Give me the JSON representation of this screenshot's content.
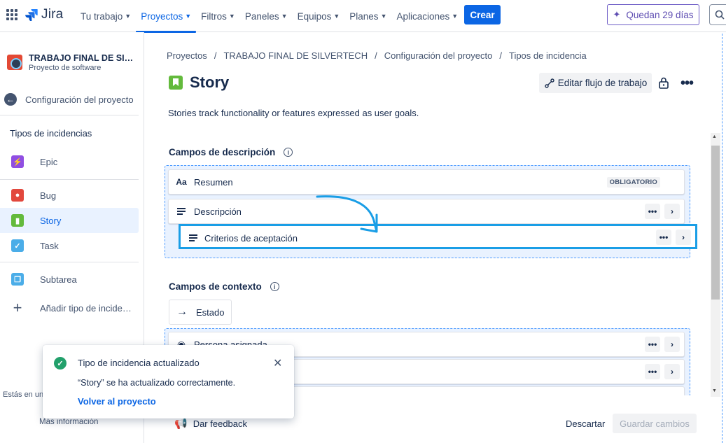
{
  "topbar": {
    "logo_text": "Jira",
    "nav": [
      {
        "label": "Tu trabajo"
      },
      {
        "label": "Proyectos"
      },
      {
        "label": "Filtros"
      },
      {
        "label": "Paneles"
      },
      {
        "label": "Equipos"
      },
      {
        "label": "Planes"
      },
      {
        "label": "Aplicaciones"
      }
    ],
    "create_label": "Crear",
    "trial_label": "Quedan 29 días"
  },
  "sidebar": {
    "project_name": "TRABAJO FINAL DE SILVERTECH",
    "project_type": "Proyecto de software",
    "back_label": "Configuración del proyecto",
    "section_title": "Tipos de incidencias",
    "items": [
      {
        "label": "Epic",
        "icon": "epic-icon"
      },
      {
        "label": "Bug",
        "icon": "bug-icon"
      },
      {
        "label": "Story",
        "icon": "story-icon"
      },
      {
        "label": "Task",
        "icon": "task-icon"
      },
      {
        "label": "Subtarea",
        "icon": "subtask-icon"
      },
      {
        "label": "Añadir tipo de incidencia",
        "icon": "plus-icon"
      }
    ],
    "footer_text": "Estás en un",
    "more_info": "Más información"
  },
  "breadcrumbs": [
    "Proyectos",
    "/",
    "TRABAJO FINAL DE SILVERTECH",
    "/",
    "Configuración del proyecto",
    "/",
    "Tipos de incidencia"
  ],
  "header": {
    "title": "Story",
    "edit_workflow_label": "Editar flujo de trabajo",
    "description": "Stories track functionality or features expressed as user goals."
  },
  "description_fields": {
    "title": "Campos de descripción",
    "fields": [
      {
        "label": "Resumen",
        "icon": "Aa",
        "badge": "OBLIGATORIO"
      },
      {
        "label": "Descripción"
      },
      {
        "label": "Criterios de aceptación"
      }
    ]
  },
  "context_fields": {
    "title": "Campos de contexto",
    "estado_label": "Estado",
    "fields": [
      {
        "label": "Persona asignada"
      }
    ]
  },
  "toast": {
    "title": "Tipo de incidencia actualizado",
    "message": "“Story” se ha actualizado correctamente.",
    "link": "Volver al proyecto"
  },
  "footer": {
    "feedback_label": "Dar feedback",
    "discard_label": "Descartar",
    "save_label": "Guardar cambios"
  },
  "colors": {
    "accent": "#0c66e4",
    "highlight": "#1a9ee6",
    "story": "#63ba3c"
  }
}
